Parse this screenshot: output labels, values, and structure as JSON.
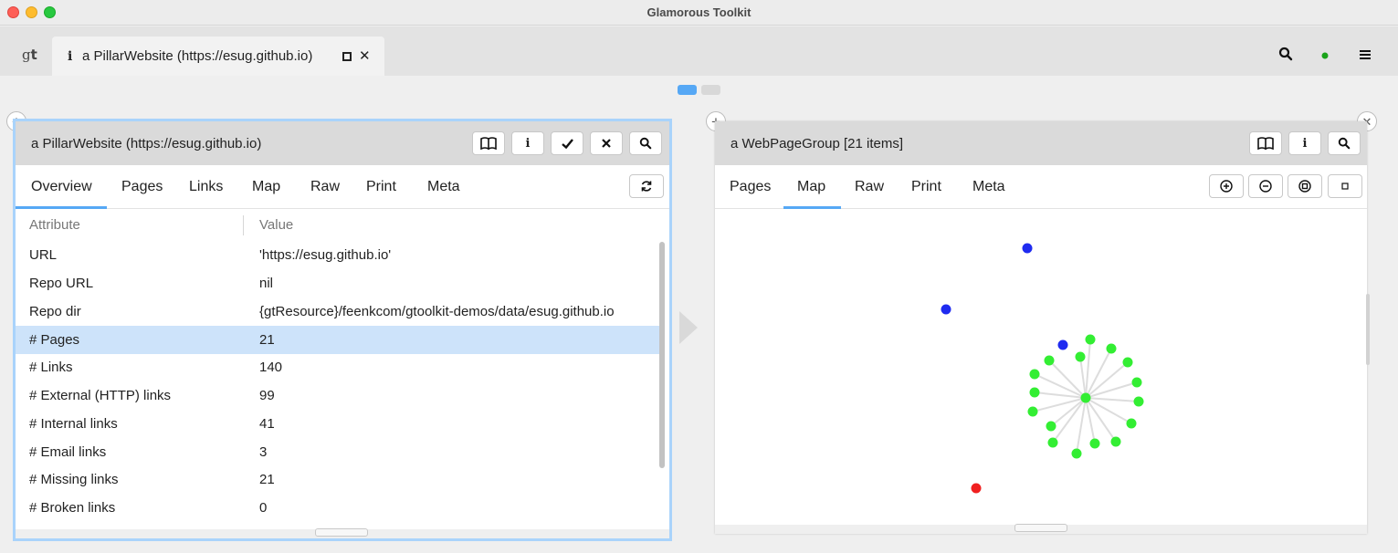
{
  "window": {
    "title": "Glamorous Toolkit"
  },
  "tabstrip": {
    "logo_g": "g",
    "logo_t": "t",
    "active_tab_icon": "i",
    "active_tab_label": "a PillarWebsite (https://esug.github.io)",
    "active_tab_close": "✕"
  },
  "left_pane": {
    "title": "a PillarWebsite (https://esug.github.io)",
    "tabs": [
      "Overview",
      "Pages",
      "Links",
      "Map",
      "Raw",
      "Print",
      "Meta"
    ],
    "selected_tab": "Overview",
    "columns": {
      "attribute": "Attribute",
      "value": "Value"
    },
    "rows": [
      {
        "attr": "URL",
        "value": "'https://esug.github.io'"
      },
      {
        "attr": "Repo URL",
        "value": "nil"
      },
      {
        "attr": "Repo dir",
        "value": "{gtResource}/feenkcom/gtoolkit-demos/data/esug.github.io"
      },
      {
        "attr": "# Pages",
        "value": "21"
      },
      {
        "attr": "# Links",
        "value": "140"
      },
      {
        "attr": "# External (HTTP) links",
        "value": "99"
      },
      {
        "attr": "# Internal links",
        "value": "41"
      },
      {
        "attr": "# Email links",
        "value": "3"
      },
      {
        "attr": "# Missing links",
        "value": "21"
      },
      {
        "attr": "# Broken links",
        "value": "0"
      }
    ],
    "selected_row": "# Pages"
  },
  "right_pane": {
    "title": "a WebPageGroup [21 items]",
    "tabs": [
      "Pages",
      "Map",
      "Raw",
      "Print",
      "Meta"
    ],
    "selected_tab": "Map",
    "map": {
      "node_colors": {
        "hub": "#33ee33",
        "external": "#1f2bf0",
        "broken": "#f02020"
      },
      "edge_color": "#dddddd"
    }
  },
  "colors": {
    "accent": "#56a8f5",
    "selection": "#cde3fa",
    "status_dot": "#1aa31a"
  }
}
